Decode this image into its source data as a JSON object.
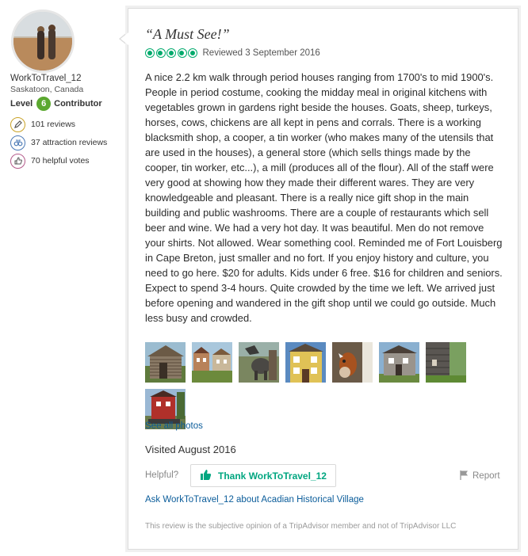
{
  "reviewer": {
    "username": "WorkToTravel_12",
    "location": "Saskatoon, Canada",
    "level_prefix": "Level",
    "level_number": "6",
    "level_suffix": "Contributor",
    "stats": [
      {
        "icon": "pencil-icon",
        "text": "101 reviews"
      },
      {
        "icon": "binoculars-icon",
        "text": "37 attraction reviews"
      },
      {
        "icon": "thumbs-up-icon",
        "text": "70 helpful votes"
      }
    ]
  },
  "review": {
    "title": "“A Must See!”",
    "rating": 5,
    "rating_max": 5,
    "reviewed_date": "Reviewed 3 September 2016",
    "body": "A nice 2.2 km walk through period houses ranging from 1700's to mid 1900's. People in period costume, cooking the midday meal in original kitchens with vegetables grown in gardens right beside the houses. Goats, sheep, turkeys, horses, cows, chickens are all kept in pens and corrals. There is a working blacksmith shop, a cooper, a tin worker (who makes many of the utensils that are used in the houses), a general store (which sells things made by the cooper, tin worker, etc...), a mill (produces all of the flour). All of the staff were very good at showing how they made their different wares. They are very knowledgeable and pleasant. There is a really nice gift shop in the main building and public washrooms. There are a couple of restaurants which sell beer and wine. We had a very hot day. It was beautiful. Men do not remove your shirts. Not allowed. Wear something cool. Reminded me of Fort Louisberg in Cape Breton, just smaller and no fort. If you enjoy history and culture, you need to go here. $20 for adults. Kids under 6 free. $16 for children and seniors. Expect to spend 3-4 hours. Quite crowded by the time we left. We arrived just before opening and wandered in the gift shop until we could go outside. Much less busy and crowded.",
    "see_all_photos": "See all photos",
    "visited": "Visited August 2016",
    "helpful_label": "Helpful?",
    "thank_label": "Thank WorkToTravel_12",
    "report_label": "Report",
    "ask_label": "Ask WorkToTravel_12 about Acadian Historical Village",
    "disclaimer": "This review is the subjective opinion of a TripAdvisor member and not of TripAdvisor LLC"
  },
  "colors": {
    "rating_green": "#00aa6c",
    "level_badge": "#5ba830",
    "link_blue": "#0a5c9a",
    "thank_green": "#00a680"
  }
}
